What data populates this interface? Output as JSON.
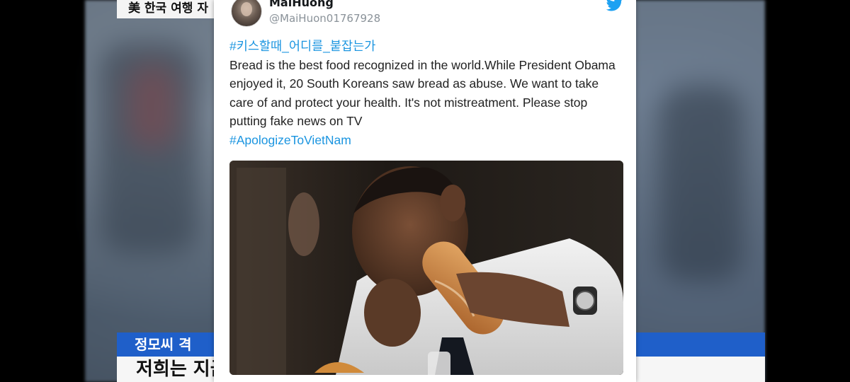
{
  "news": {
    "top_headline": "美 한국 여행 자",
    "caption_blue": "정모씨 격",
    "caption_white": "저희는 지금"
  },
  "tweet": {
    "display_name": "MaiHuong",
    "handle": "@MaiHuon01767928",
    "hashtag_top": "#키스할때_어디를_붙잡는가",
    "text": "Bread is the best food recognized in the world.While President Obama enjoyed it, 20 South Koreans saw bread as abuse. We want to take care of and protect your health. It's not mistreatment. Please stop putting fake news on TV",
    "hashtag_bottom": "#ApologizeToVietNam"
  },
  "icons": {
    "brand": "twitter-bird-icon",
    "avatar": "avatar"
  },
  "colors": {
    "hashtag": "#1b95e0",
    "twitter_blue": "#1da1f2",
    "news_bar_blue": "#1f5fc9"
  }
}
